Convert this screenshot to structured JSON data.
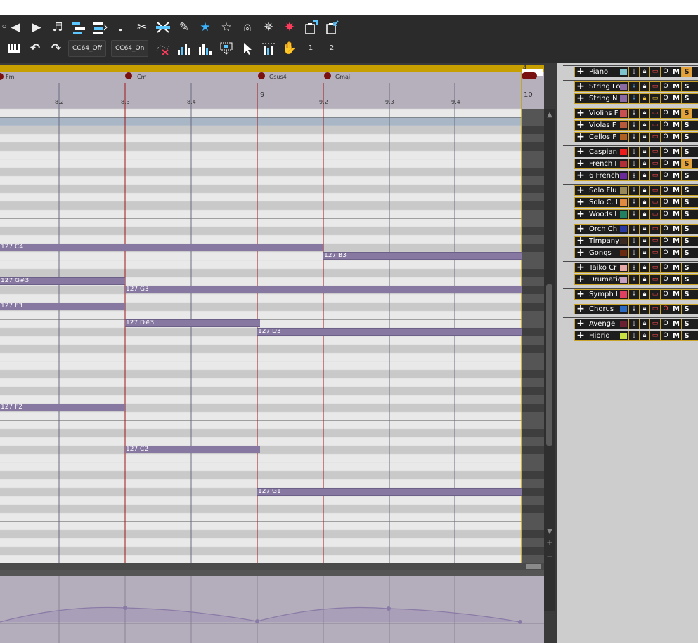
{
  "toolbar": {
    "row1_icons": [
      "eraser-icon",
      "arrow-left-icon",
      "arrow-right-icon",
      "notes-icon",
      "quantize-icon",
      "duplicate-icon",
      "note-length-icon",
      "scissors-icon",
      "glue-icon",
      "pencil-icon",
      "star-filled-icon",
      "star-outline-icon",
      "bell-icon",
      "explode-icon",
      "burst-icon",
      "clipboard-export-icon",
      "clipboard-import-icon"
    ],
    "row2_icons": [
      "piano-keys-icon",
      "undo-icon",
      "redo-icon"
    ],
    "cc64_off_label": "CC64_Off",
    "cc64_on_label": "CC64_On",
    "row2_tools": [
      "remove-cc-icon",
      "velocity-ramp-up-icon",
      "velocity-ramp-down-icon",
      "velocity-random-icon",
      "select-arrow-icon",
      "humanize-icon",
      "hand-icon"
    ],
    "page_buttons": [
      "1",
      "2"
    ]
  },
  "ruler": {
    "top_marker": "4",
    "chords": [
      "Fm",
      "Cm",
      "Gsus4",
      "Gmaj"
    ],
    "ticks": [
      "8.2",
      "8.3",
      "8.4",
      "9",
      "9.2",
      "9.3",
      "9.4",
      "10"
    ]
  },
  "notes": [
    {
      "label": "127 C4"
    },
    {
      "label": "127 B3"
    },
    {
      "label": "127 G#3"
    },
    {
      "label": "127 G3"
    },
    {
      "label": "127 F3"
    },
    {
      "label": "127 D#3"
    },
    {
      "label": "127 D3"
    },
    {
      "label": "127 F2"
    },
    {
      "label": "127 C2"
    },
    {
      "label": "127 G1"
    }
  ],
  "tracks": [
    {
      "name": "Piano",
      "color": "#7fc4cc",
      "solo": true
    },
    {
      "name": "String Lo",
      "color": "#8a6aa0",
      "solo": false
    },
    {
      "name": "String N",
      "color": "#8a6aa0",
      "solo": false
    },
    {
      "name": "Violins F",
      "color": "#c85050",
      "solo": true
    },
    {
      "name": "Violas F",
      "color": "#b85a3a",
      "solo": false
    },
    {
      "name": "Cellos F",
      "color": "#b06020",
      "solo": false
    },
    {
      "name": "Caspian",
      "color": "#ee1b1b",
      "solo": false
    },
    {
      "name": "French I",
      "color": "#b0303a",
      "solo": true
    },
    {
      "name": "6 French",
      "color": "#6a2a9a",
      "solo": false
    },
    {
      "name": "Solo Flu",
      "color": "#9a8a5a",
      "solo": false
    },
    {
      "name": "Solo C. I",
      "color": "#e08a40",
      "solo": false
    },
    {
      "name": "Woods I",
      "color": "#208060",
      "solo": false
    },
    {
      "name": "Orch Ch",
      "color": "#2a3aa0",
      "solo": false
    },
    {
      "name": "Timpany",
      "color": "#3a2a20",
      "solo": false
    },
    {
      "name": "Gongs",
      "color": "#6a2a10",
      "solo": false
    },
    {
      "name": "Taiko Cr",
      "color": "#e8a8a8",
      "solo": false
    },
    {
      "name": "Drumatic",
      "color": "#c8a0c0",
      "solo": false
    },
    {
      "name": "Symph I",
      "color": "#e04060",
      "solo": false
    },
    {
      "name": "Chorus",
      "color": "#2a6ac0",
      "solo": false
    },
    {
      "name": "Avenge",
      "color": "#6a2030",
      "solo": false
    },
    {
      "name": "Hibrid",
      "color": "#c8e040",
      "solo": false
    }
  ],
  "track_controls": {
    "mute_label": "M",
    "solo_label": "S",
    "record_label": "O"
  },
  "colors": {
    "note": "#8678a1",
    "ruler": "#c7a000",
    "chord_marker": "#7a1111",
    "panel_bg": "#2b2b2b",
    "solo_on": "#e6a23a"
  }
}
